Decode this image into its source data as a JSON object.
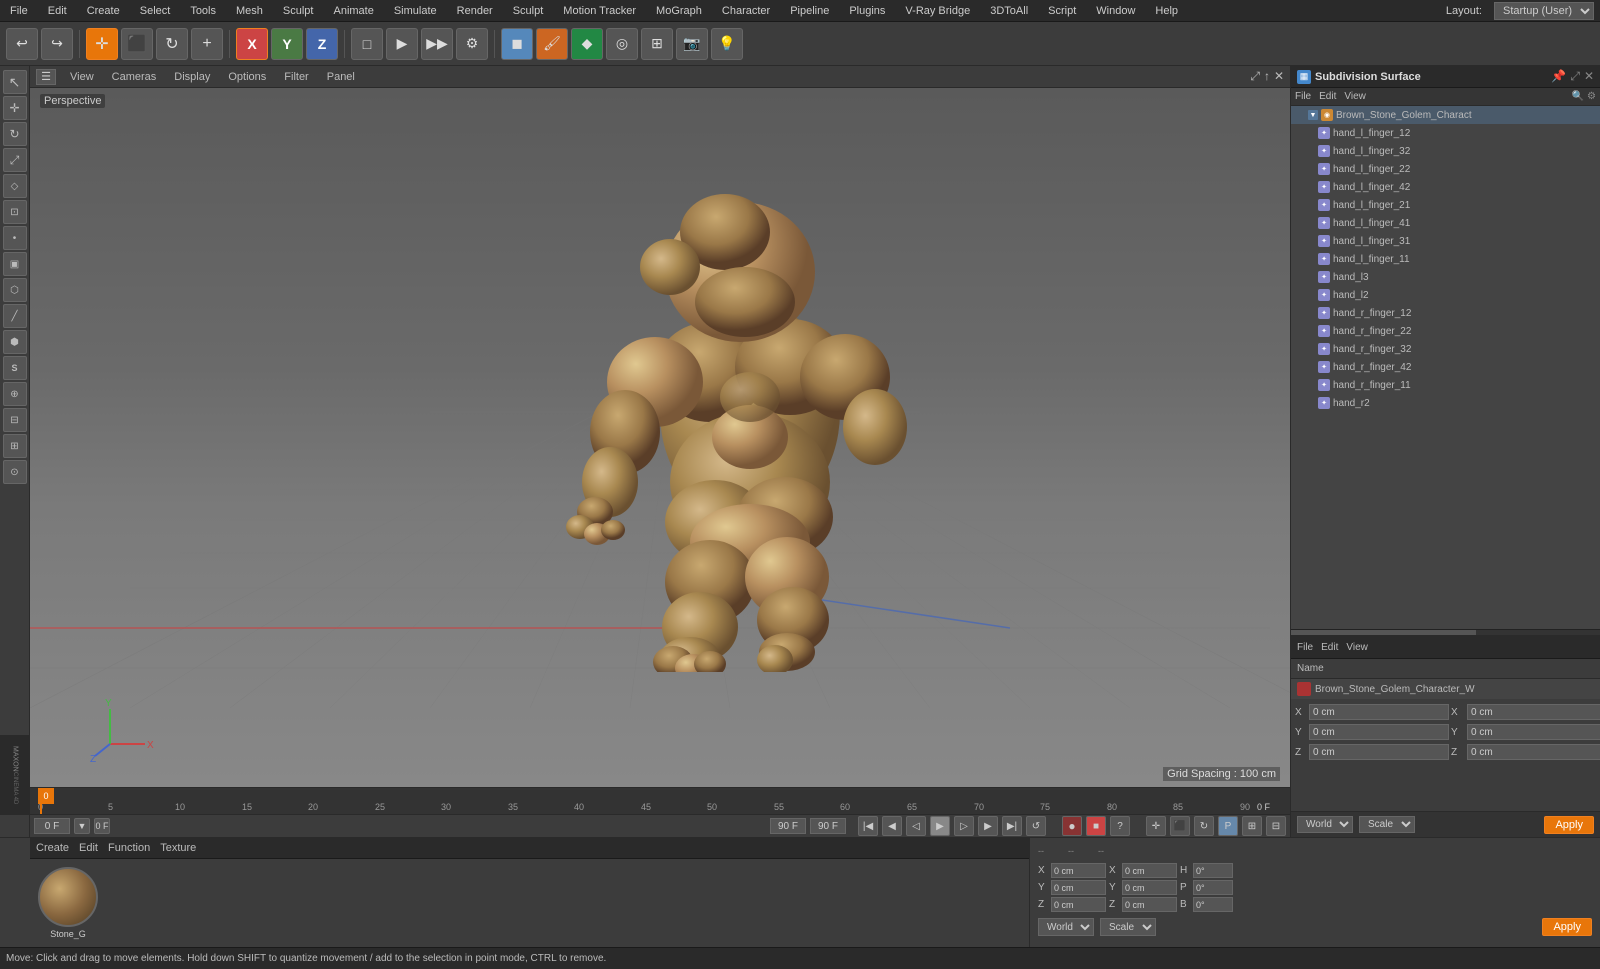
{
  "app": {
    "title": "Cinema 4D",
    "layout": "Startup (User)"
  },
  "top_menu": {
    "items": [
      "File",
      "Edit",
      "Create",
      "Select",
      "Tools",
      "Mesh",
      "Sculpt",
      "Animate",
      "Simulate",
      "Render",
      "Sculpt",
      "Motion Tracker",
      "MoGraph",
      "Character",
      "Pipeline",
      "Plugins",
      "V-Ray Bridge",
      "3DToAll",
      "Script",
      "Window",
      "Help"
    ]
  },
  "toolbar": {
    "undo_label": "↩",
    "redo_label": "↪"
  },
  "viewport": {
    "label": "Perspective",
    "grid_spacing": "Grid Spacing : 100 cm",
    "menu_items": [
      "View",
      "Cameras",
      "Display",
      "Options",
      "Filter",
      "Panel"
    ]
  },
  "timeline": {
    "current_frame": "0 F",
    "end_frame": "90 F",
    "start_label": "0 F",
    "end_label": "90 F",
    "ticks": [
      0,
      5,
      10,
      15,
      20,
      25,
      30,
      35,
      40,
      45,
      50,
      55,
      60,
      65,
      70,
      75,
      80,
      85,
      90
    ]
  },
  "right_panel": {
    "title": "Subdivision Surface",
    "top_menu": [
      "File",
      "Edit",
      "View"
    ],
    "objects": [
      {
        "name": "Brown_Stone_Golem_Charact",
        "type": "root",
        "indent": 0
      },
      {
        "name": "hand_l_finger_12",
        "type": "bone",
        "indent": 1
      },
      {
        "name": "hand_l_finger_32",
        "type": "bone",
        "indent": 1
      },
      {
        "name": "hand_l_finger_22",
        "type": "bone",
        "indent": 1
      },
      {
        "name": "hand_l_finger_42",
        "type": "bone",
        "indent": 1
      },
      {
        "name": "hand_l_finger_21",
        "type": "bone",
        "indent": 1
      },
      {
        "name": "hand_l_finger_41",
        "type": "bone",
        "indent": 1
      },
      {
        "name": "hand_l_finger_31",
        "type": "bone",
        "indent": 1
      },
      {
        "name": "hand_l_finger_11",
        "type": "bone",
        "indent": 1
      },
      {
        "name": "hand_l3",
        "type": "bone",
        "indent": 1
      },
      {
        "name": "hand_l2",
        "type": "bone",
        "indent": 1
      },
      {
        "name": "hand_r_finger_12",
        "type": "bone",
        "indent": 1
      },
      {
        "name": "hand_r_finger_22",
        "type": "bone",
        "indent": 1
      },
      {
        "name": "hand_r_finger_32",
        "type": "bone",
        "indent": 1
      },
      {
        "name": "hand_r_finger_42",
        "type": "bone",
        "indent": 1
      },
      {
        "name": "hand_r_finger_11",
        "type": "bone",
        "indent": 1
      },
      {
        "name": "hand_r2",
        "type": "bone",
        "indent": 1
      }
    ],
    "bottom_menu": [
      "File",
      "Edit",
      "View"
    ],
    "name_label": "Name",
    "object_name": "Brown_Stone_Golem_Character_W",
    "coords": {
      "x_pos": "0 cm",
      "y_pos": "0 cm",
      "z_pos": "0 cm",
      "x_rot": "0 cm",
      "y_rot": "0 cm",
      "z_rot": "0 cm",
      "h": "0°",
      "p": "0°",
      "b": "0°"
    }
  },
  "bottom_panel": {
    "menu": [
      "Create",
      "Edit",
      "Function",
      "Texture"
    ],
    "material_name": "Stone_G",
    "world_label": "World",
    "scale_label": "Scale",
    "apply_label": "Apply"
  },
  "status_bar": {
    "message": "Move: Click and drag to move elements. Hold down SHIFT to quantize movement / add to the selection in point mode, CTRL to remove."
  },
  "coords_panel": {
    "x_label": "X",
    "y_label": "Y",
    "z_label": "Z",
    "h_label": "H",
    "p_label": "P",
    "b_label": "B",
    "x_val": "0 cm",
    "y_val": "0 cm",
    "z_val": "0 cm",
    "x2_val": "0 cm",
    "y2_val": "0 cm",
    "z2_val": "0 cm",
    "h_val": "0°",
    "p_val": "0°",
    "b_val": "0°"
  }
}
